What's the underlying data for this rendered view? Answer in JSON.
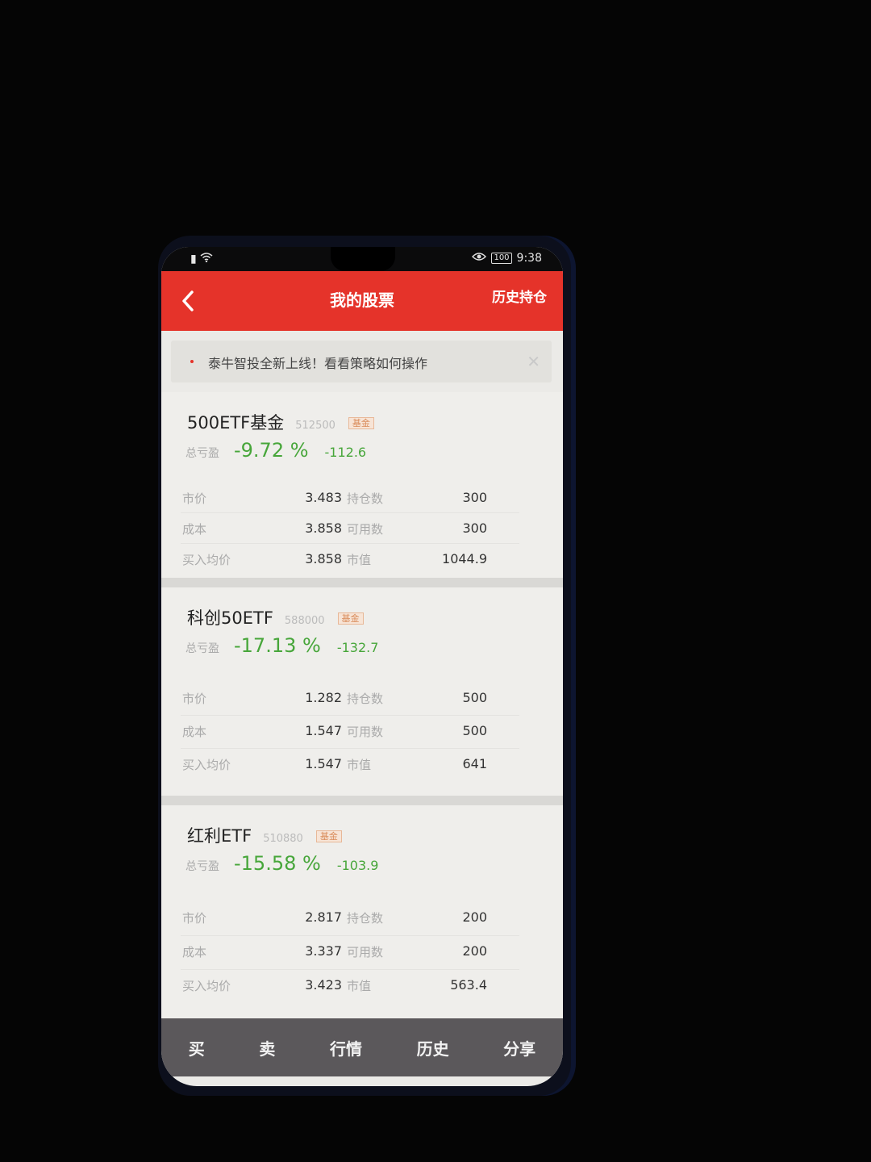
{
  "status_bar": {
    "time": "9:38",
    "battery": "100"
  },
  "header": {
    "title": "我的股票",
    "right_action": "历史持仓"
  },
  "notice": {
    "text": "泰牛智投全新上线！看看策略如何操作"
  },
  "labels": {
    "total_pl": "总亏盈",
    "badge": "基金",
    "price": "市价",
    "holding": "持仓数",
    "cost": "成本",
    "available": "可用数",
    "avg_buy": "买入均价",
    "market_value": "市值"
  },
  "holdings": [
    {
      "name": "500ETF基金",
      "code": "512500",
      "pl_pct": "-9.72 %",
      "pl_amount": "-112.6",
      "price": "3.483",
      "holding": "300",
      "cost": "3.858",
      "available": "300",
      "avg_buy": "3.858",
      "market_value": "1044.9"
    },
    {
      "name": "科创50ETF",
      "code": "588000",
      "pl_pct": "-17.13 %",
      "pl_amount": "-132.7",
      "price": "1.282",
      "holding": "500",
      "cost": "1.547",
      "available": "500",
      "avg_buy": "1.547",
      "market_value": "641"
    },
    {
      "name": "红利ETF",
      "code": "510880",
      "pl_pct": "-15.58 %",
      "pl_amount": "-103.9",
      "price": "2.817",
      "holding": "200",
      "cost": "3.337",
      "available": "200",
      "avg_buy": "3.423",
      "market_value": "563.4"
    }
  ],
  "tabbar": {
    "buy": "买",
    "sell": "卖",
    "market": "行情",
    "history": "历史",
    "share": "分享"
  },
  "colors": {
    "brand_red": "#e5332a",
    "loss_green": "#47a63a",
    "tabbar_bg": "#5b585b"
  }
}
